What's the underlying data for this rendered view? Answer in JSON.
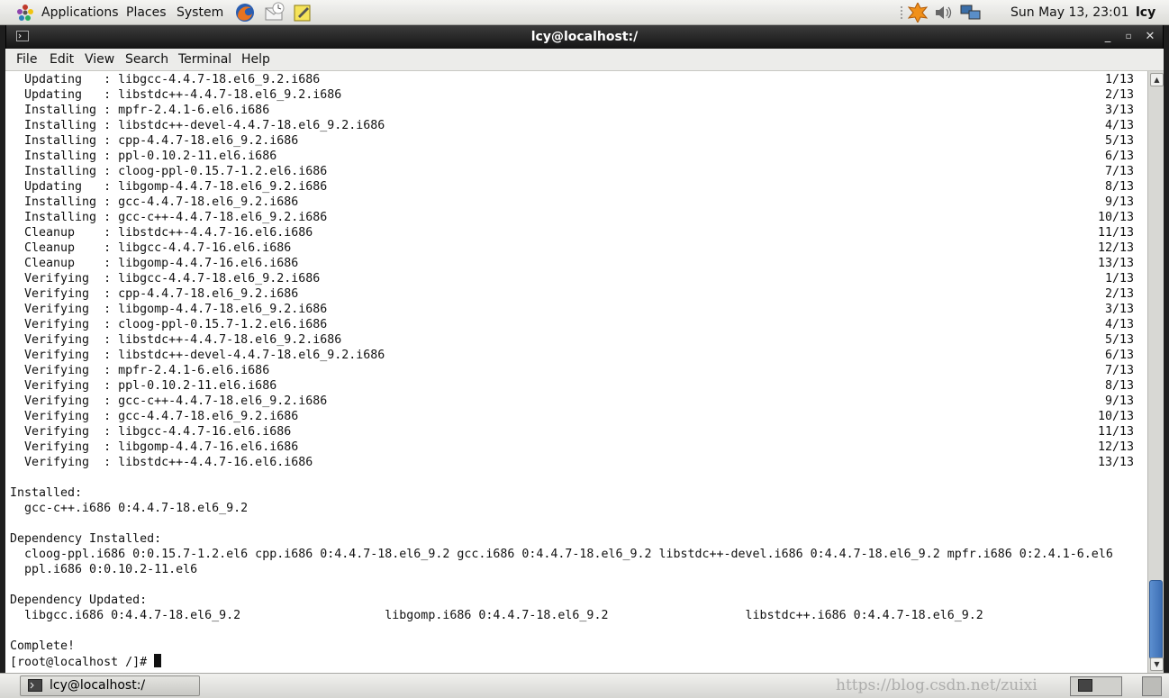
{
  "top_panel": {
    "applications": "Applications",
    "places": "Places",
    "system": "System",
    "clock": "Sun May 13, 23:01",
    "user": "lcy"
  },
  "window": {
    "title": "lcy@localhost:/",
    "minimize_glyph": "_",
    "maximize_glyph": "▫",
    "close_glyph": "✕"
  },
  "menu": [
    "File",
    "Edit",
    "View",
    "Search",
    "Terminal",
    "Help"
  ],
  "terminal": {
    "transactions": [
      {
        "text": "  Updating   : libgcc-4.4.7-18.el6_9.2.i686",
        "num": "1/13"
      },
      {
        "text": "  Updating   : libstdc++-4.4.7-18.el6_9.2.i686",
        "num": "2/13"
      },
      {
        "text": "  Installing : mpfr-2.4.1-6.el6.i686",
        "num": "3/13"
      },
      {
        "text": "  Installing : libstdc++-devel-4.4.7-18.el6_9.2.i686",
        "num": "4/13"
      },
      {
        "text": "  Installing : cpp-4.4.7-18.el6_9.2.i686",
        "num": "5/13"
      },
      {
        "text": "  Installing : ppl-0.10.2-11.el6.i686",
        "num": "6/13"
      },
      {
        "text": "  Installing : cloog-ppl-0.15.7-1.2.el6.i686",
        "num": "7/13"
      },
      {
        "text": "  Updating   : libgomp-4.4.7-18.el6_9.2.i686",
        "num": "8/13"
      },
      {
        "text": "  Installing : gcc-4.4.7-18.el6_9.2.i686",
        "num": "9/13"
      },
      {
        "text": "  Installing : gcc-c++-4.4.7-18.el6_9.2.i686",
        "num": "10/13"
      },
      {
        "text": "  Cleanup    : libstdc++-4.4.7-16.el6.i686",
        "num": "11/13"
      },
      {
        "text": "  Cleanup    : libgcc-4.4.7-16.el6.i686",
        "num": "12/13"
      },
      {
        "text": "  Cleanup    : libgomp-4.4.7-16.el6.i686",
        "num": "13/13"
      },
      {
        "text": "  Verifying  : libgcc-4.4.7-18.el6_9.2.i686",
        "num": "1/13"
      },
      {
        "text": "  Verifying  : cpp-4.4.7-18.el6_9.2.i686",
        "num": "2/13"
      },
      {
        "text": "  Verifying  : libgomp-4.4.7-18.el6_9.2.i686",
        "num": "3/13"
      },
      {
        "text": "  Verifying  : cloog-ppl-0.15.7-1.2.el6.i686",
        "num": "4/13"
      },
      {
        "text": "  Verifying  : libstdc++-4.4.7-18.el6_9.2.i686",
        "num": "5/13"
      },
      {
        "text": "  Verifying  : libstdc++-devel-4.4.7-18.el6_9.2.i686",
        "num": "6/13"
      },
      {
        "text": "  Verifying  : mpfr-2.4.1-6.el6.i686",
        "num": "7/13"
      },
      {
        "text": "  Verifying  : ppl-0.10.2-11.el6.i686",
        "num": "8/13"
      },
      {
        "text": "  Verifying  : gcc-c++-4.4.7-18.el6_9.2.i686",
        "num": "9/13"
      },
      {
        "text": "  Verifying  : gcc-4.4.7-18.el6_9.2.i686",
        "num": "10/13"
      },
      {
        "text": "  Verifying  : libgcc-4.4.7-16.el6.i686",
        "num": "11/13"
      },
      {
        "text": "  Verifying  : libgomp-4.4.7-16.el6.i686",
        "num": "12/13"
      },
      {
        "text": "  Verifying  : libstdc++-4.4.7-16.el6.i686",
        "num": "13/13"
      }
    ],
    "installed_header": "Installed:",
    "installed_line": "  gcc-c++.i686 0:4.4.7-18.el6_9.2",
    "dep_installed_header": "Dependency Installed:",
    "dep_installed_line1": "  cloog-ppl.i686 0:0.15.7-1.2.el6 cpp.i686 0:4.4.7-18.el6_9.2 gcc.i686 0:4.4.7-18.el6_9.2 libstdc++-devel.i686 0:4.4.7-18.el6_9.2 mpfr.i686 0:2.4.1-6.el6",
    "dep_installed_line2": "  ppl.i686 0:0.10.2-11.el6",
    "dep_updated_header": "Dependency Updated:",
    "dep_updated_line": "  libgcc.i686 0:4.4.7-18.el6_9.2                    libgomp.i686 0:4.4.7-18.el6_9.2                   libstdc++.i686 0:4.4.7-18.el6_9.2",
    "complete": "Complete!",
    "prompt": "[root@localhost /]# "
  },
  "taskbar": {
    "task_label": "lcy@localhost:/",
    "watermark": "https://blog.csdn.net/zuixi"
  }
}
